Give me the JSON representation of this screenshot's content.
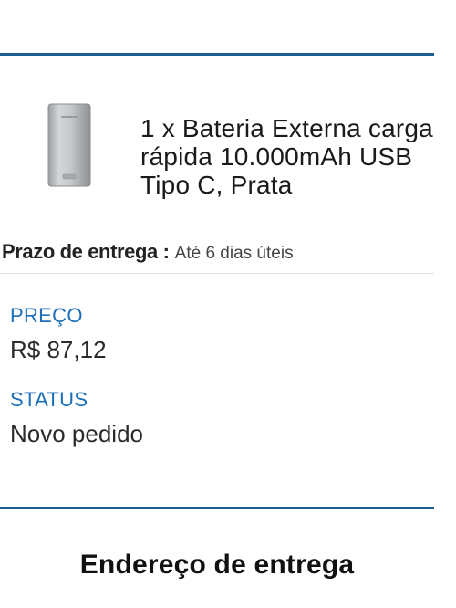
{
  "product": {
    "title": "1 x Bateria Externa carga rápida 10.000mAh USB Tipo C, Prata",
    "image_icon": "power-bank-image"
  },
  "delivery": {
    "label": "Prazo de entrega :",
    "value": "Até 6 dias úteis"
  },
  "price": {
    "label": "PREÇO",
    "value": "R$ 87,12"
  },
  "status": {
    "label": "STATUS",
    "value": "Novo pedido"
  },
  "address": {
    "heading": "Endereço de entrega"
  },
  "colors": {
    "accent_blue": "#1b5d91",
    "label_blue": "#1b6fb8",
    "divider_gray": "#e3e3e3"
  }
}
